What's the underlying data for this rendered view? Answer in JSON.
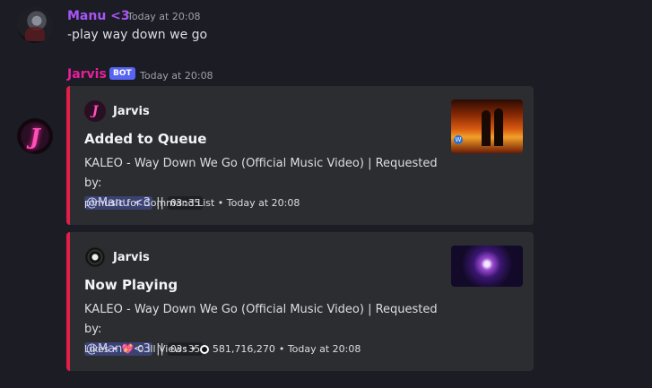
{
  "messages": [
    {
      "username": "Manu <3",
      "username_color": "#a855f7",
      "timestamp": "Today at 20:08",
      "content": "-play way down we go"
    },
    {
      "username": "Jarvis",
      "username_color": "#e91e9c",
      "bot_tag": "BOT",
      "timestamp": "Today at 20:08",
      "embeds": [
        {
          "author": "Jarvis",
          "title": "Added to Queue",
          "desc_line": "KALEO - Way Down We Go (Official Music Video) | Requested by:",
          "mention": "@Manu <3",
          "separator": "||",
          "duration": "03:35",
          "footer": "p!music for Command List • Today at 20:08"
        },
        {
          "author": "Jarvis",
          "title": "Now Playing",
          "desc_line": "KALEO - Way Down We Go (Official Music Video) | Requested by:",
          "mention": "@Manu <3",
          "separator": "||",
          "duration": "03:35",
          "footer_likes_label": "Likes •",
          "footer_likes_icon": "heart-icon",
          "footer_likes": "0",
          "footer_views_label": "ıll Views •",
          "footer_views_icon": "eye-icon",
          "footer_views": "581,716,270",
          "footer_time": "• Today at 20:08"
        }
      ]
    }
  ],
  "colors": {
    "embed_accent": "#e11d48",
    "bot_tag": "#5865f2"
  }
}
